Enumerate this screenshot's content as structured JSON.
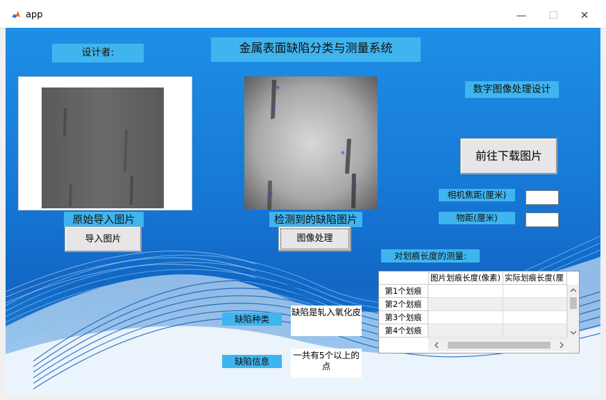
{
  "window": {
    "title": "app",
    "minimize_glyph": "—",
    "maximize_glyph": "☐",
    "close_glyph": "✕"
  },
  "labels": {
    "designer": "设计者:",
    "system_title": "金属表面缺陷分类与测量系统",
    "digital_design": "数字图像处理设计",
    "original_caption": "原始导入图片",
    "detected_caption": "检测到的缺陷图片",
    "focal_length": "相机焦距(厘米)",
    "object_distance": "物距(厘米)",
    "scratch_measure": "对划痕长度的测量:",
    "defect_type": "缺陷种类",
    "defect_info": "缺陷信息"
  },
  "buttons": {
    "import": "导入图片",
    "process": "图像处理",
    "download": "前往下载图片"
  },
  "inputs": {
    "focal_length_value": "",
    "object_distance_value": ""
  },
  "results": {
    "defect_type_text": "缺陷是轧入氧化皮",
    "defect_info_text": "一共有5个以上的点"
  },
  "table": {
    "columns": [
      "图片划痕长度(像素)",
      "实际划痕长度(厘"
    ],
    "rows": [
      "第1个划痕",
      "第2个划痕",
      "第3个划痕",
      "第4个划痕"
    ]
  },
  "colors": {
    "background": "#1473d0",
    "label_fill": "#3fb5ef",
    "marker": "#1f4fd8"
  },
  "icons": {
    "app": "matlab-icon",
    "scroll_up": "chevron-up-icon",
    "scroll_down": "chevron-down-icon",
    "scroll_left": "chevron-left-icon",
    "scroll_right": "chevron-right-icon"
  }
}
